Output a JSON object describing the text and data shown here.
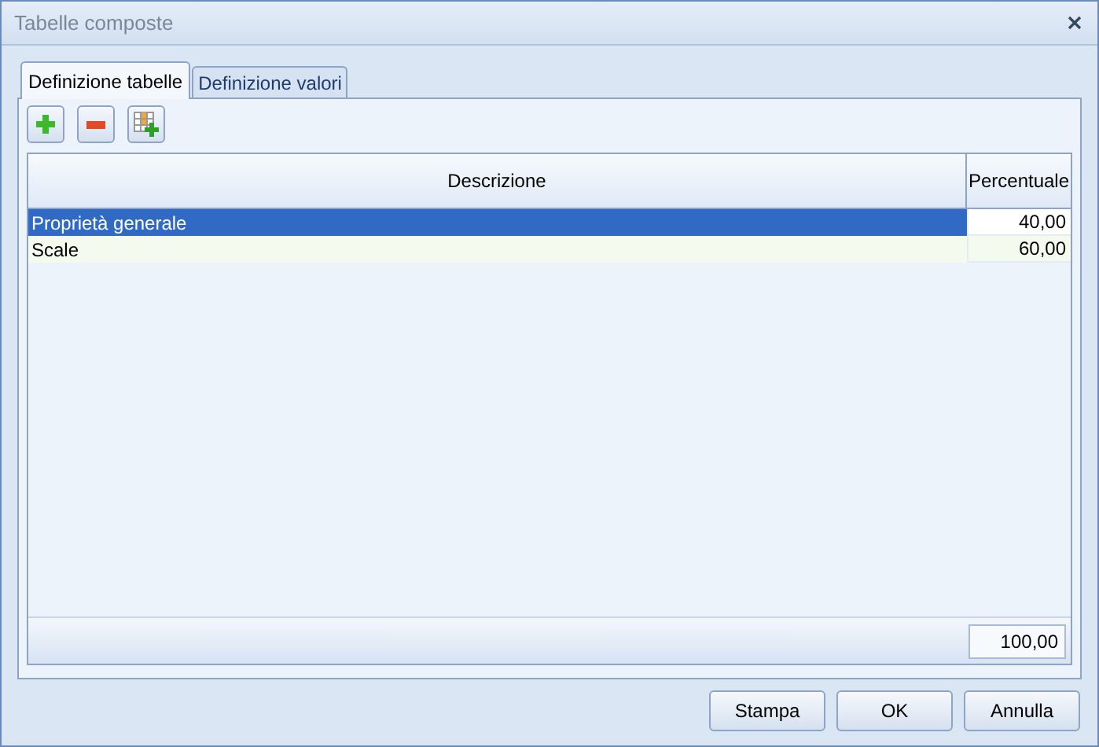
{
  "window": {
    "title": "Tabelle composte"
  },
  "tabs": [
    {
      "label": "Definizione tabelle",
      "selected": true
    },
    {
      "label": "Definizione valori",
      "selected": false
    }
  ],
  "table": {
    "columns": [
      "Descrizione",
      "Percentuale"
    ],
    "rows": [
      {
        "cells": [
          "Proprietà generale",
          "40,00"
        ],
        "selected": true
      },
      {
        "cells": [
          "Scale",
          "60,00"
        ],
        "selected": false
      }
    ],
    "total": "100,00"
  },
  "buttons": [
    "Stampa",
    "OK",
    "Annulla"
  ]
}
